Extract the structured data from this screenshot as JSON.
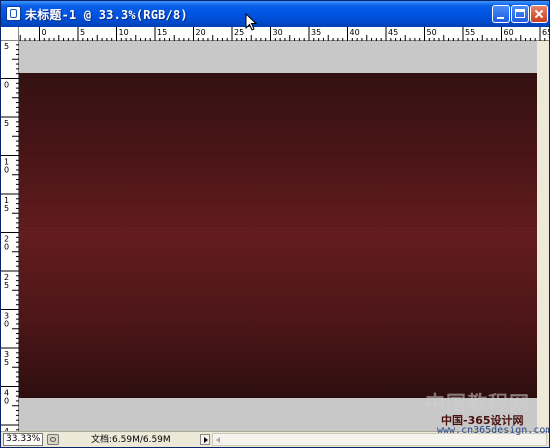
{
  "window": {
    "title": "未标题-1 @ 33.3%(RGB/8)"
  },
  "ruler_h": {
    "labels": [
      "5",
      "0",
      "5",
      "10",
      "15",
      "20",
      "25",
      "30",
      "35",
      "40",
      "45",
      "50",
      "55",
      "60",
      "65"
    ]
  },
  "ruler_v": {
    "labels": [
      "5",
      "0",
      "5",
      "10",
      "15",
      "20",
      "25",
      "30",
      "35",
      "40",
      "45"
    ]
  },
  "status": {
    "zoom": "33.33%",
    "doc_info": "文档:6.59M/6.59M"
  },
  "watermark": {
    "line1": "中国教程网",
    "line2": "中国-365设计网",
    "line3": "www.cn365design.com"
  },
  "colors": {
    "titlebar": "#0054e3",
    "canvas_gray": "#c8c8c8",
    "doc_center": "#641c1f",
    "doc_edge": "#2e0e0f"
  }
}
